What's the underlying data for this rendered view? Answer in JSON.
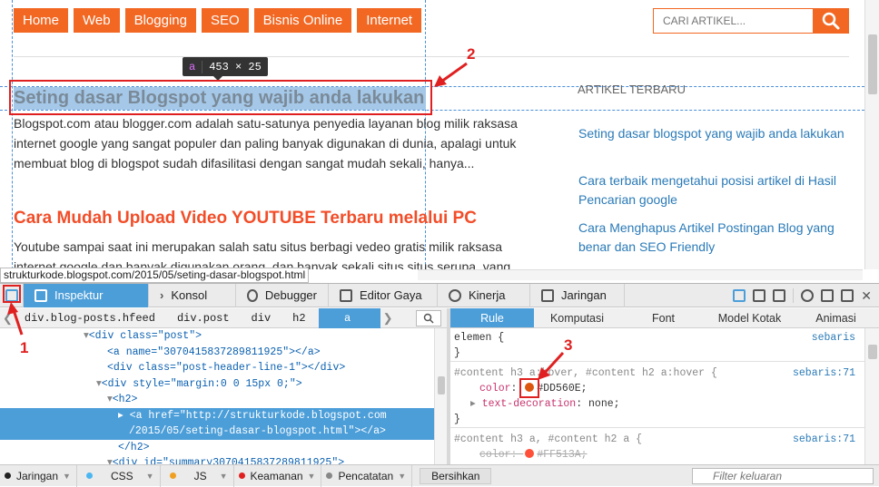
{
  "nav": {
    "items": [
      "Home",
      "Web",
      "Blogging",
      "SEO",
      "Bisnis Online",
      "Internet"
    ]
  },
  "search": {
    "placeholder": "CARI ARTIKEL...",
    "icon": "search-icon"
  },
  "tooltip": {
    "tag": "a",
    "size": "453 × 25"
  },
  "posts": [
    {
      "title": "Seting dasar Blogspot yang wajib anda lakukan",
      "lines": [
        "Blogspot.com atau blogger.com adalah satu-satunya penyedia layanan blog milik raksasa",
        "internet google yang sangat populer dan paling banyak digunakan di dunia, apalagi untuk",
        "membuat blog di blogspot sudah difasilitasi dengan sangat mudah sekali, hanya..."
      ]
    },
    {
      "title": "Cara Mudah Upload Video YOUTUBE Terbaru melalui PC",
      "lines": [
        "Youtube sampai saat ini merupakan salah satu situs berbagi vedeo gratis milik raksasa",
        "internet google dan banyak digunakan orang, dan banyak sekali situs situs serupa, yang"
      ]
    }
  ],
  "sidebar": {
    "heading": "ARTIKEL TERBARU",
    "links": [
      "Seting dasar blogspot yang wajib anda lakukan",
      "Cara terbaik mengetahui posisi artikel di Hasil Pencarian google",
      "Cara Menghapus Artikel Postingan Blog yang benar dan SEO Friendly"
    ]
  },
  "status_url": "strukturkode.blogspot.com/2015/05/seting-dasar-blogspot.html",
  "annotations": [
    "1",
    "2",
    "3"
  ],
  "devtools": {
    "tabs": [
      "Inspektur",
      "Konsol",
      "Debugger",
      "Editor Gaya",
      "Kinerja",
      "Jaringan"
    ],
    "breadcrumbs": [
      "div.blog-posts.hfeed",
      "div.post",
      "div",
      "h2",
      "a"
    ],
    "markup": [
      "<div class=\"post\">",
      "<a name=\"3070415837289811925\"></a>",
      "<div class=\"post-header-line-1\"></div>",
      "<div style=\"margin:0 0 15px 0;\">",
      "<h2>",
      "<a href=\"http://strukturkode.blogspot.com",
      "/2015/05/seting-dasar-blogspot.html\"></a>",
      "</h2>",
      "<div id=\"summary3070415837289811925\">"
    ],
    "right_tabs": [
      "Rule",
      "Komputasi",
      "Font",
      "Model Kotak",
      "Animasi"
    ],
    "rules": {
      "element_selector": "elemen {",
      "element_source": "sebaris",
      "close": "}",
      "rule1_selector": "#content h3 a:hover, #content h2 a:hover {",
      "rule1_source": "sebaris:71",
      "rule1_prop1": "color",
      "rule1_val1": "#DD560E;",
      "rule1_prop2": "text-decoration",
      "rule1_val2": "none;",
      "rule2_selector": "#content h3 a, #content h2 a {",
      "rule2_source": "sebaris:71",
      "rule2_prop1": "color",
      "rule2_val1": "#FF513A;"
    },
    "console_filters": [
      "Jaringan",
      "CSS",
      "JS",
      "Keamanan",
      "Pencatatan"
    ],
    "clear_label": "Bersihkan",
    "filter_placeholder": "Filter keluaran"
  },
  "colors": {
    "accent": "#F26722",
    "hover_swatch": "#DD560E",
    "link_swatch": "#FF513A",
    "devtools_blue": "#4C9ED9"
  }
}
